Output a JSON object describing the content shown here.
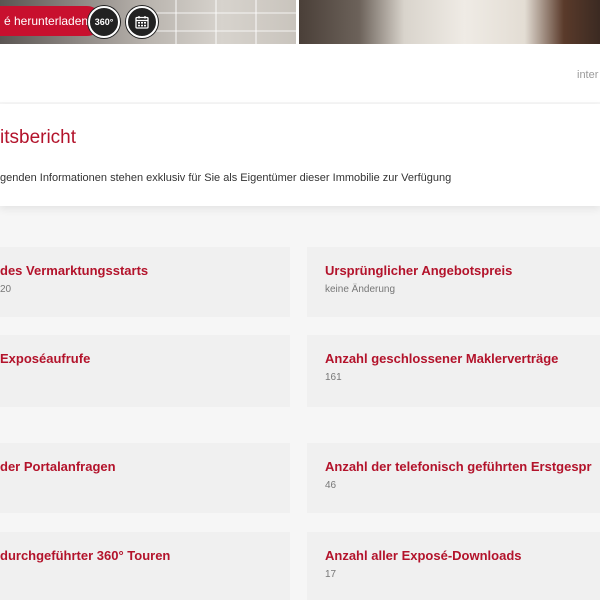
{
  "toolbar": {
    "download_label": "é herunterladen",
    "tour_label": "360°",
    "calendar_icon": "calendar-icon"
  },
  "header": {
    "truncated_text": "inter"
  },
  "report": {
    "title": "itsbericht",
    "subtitle": "genden Informationen stehen exklusiv für Sie als Eigentümer dieser Immobilie zur Verfügung"
  },
  "stats": [
    {
      "title": "des Vermarktungsstarts",
      "value": "20"
    },
    {
      "title": "Ursprünglicher Angebotspreis",
      "value": "keine Änderung"
    },
    {
      "title": "Exposéaufrufe",
      "value": ""
    },
    {
      "title": "Anzahl geschlossener Maklerverträge",
      "value": "161"
    },
    {
      "title": "der Portalanfragen",
      "value": ""
    },
    {
      "title": "Anzahl der telefonisch geführten Erstgespr",
      "value": "46"
    },
    {
      "title": "durchgeführter 360° Touren",
      "value": ""
    },
    {
      "title": "Anzahl aller Exposé-Downloads",
      "value": "17"
    }
  ],
  "colors": {
    "accent": "#b3132b",
    "button": "#c8102e",
    "card_bg": "#f0f0f0"
  }
}
